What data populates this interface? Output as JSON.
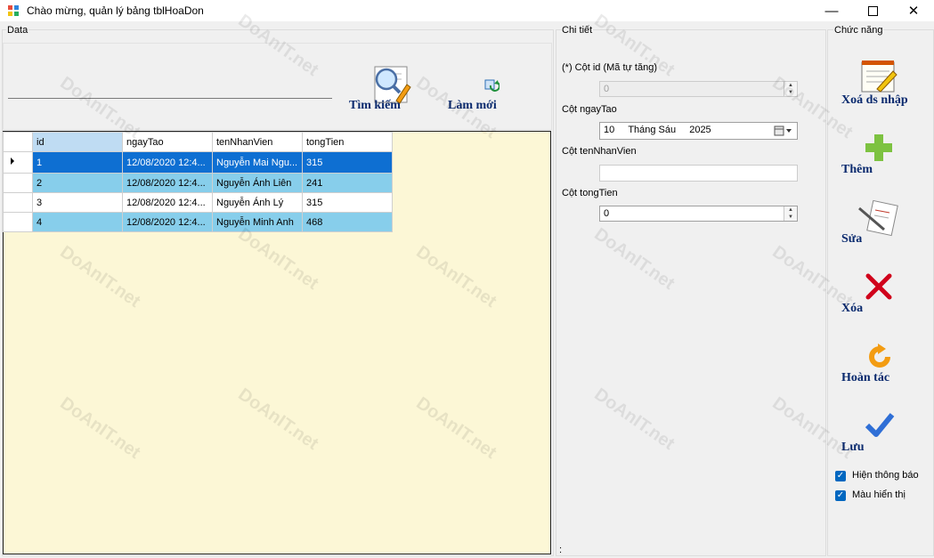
{
  "window": {
    "title": "Chào mừng, quản lý bảng tblHoaDon",
    "minimize_icon": "minimize-icon",
    "maximize_icon": "maximize-icon",
    "close_icon": "close-icon"
  },
  "data_group": {
    "label": "Data",
    "search": {
      "value": "",
      "placeholder": ""
    },
    "search_button": "Tìm kiếm",
    "refresh_button": "Làm mới",
    "grid": {
      "columns": [
        "id",
        "ngayTao",
        "tenNhanVien",
        "tongTien"
      ],
      "rows": [
        [
          "1",
          "12/08/2020 12:4...",
          "Nguyễn Mai Ngu...",
          "315"
        ],
        [
          "2",
          "12/08/2020 12:4...",
          "Nguyễn Ánh Liên",
          "241"
        ],
        [
          "3",
          "12/08/2020 12:4...",
          "Nguyễn Ánh Lý",
          "315"
        ],
        [
          "4",
          "12/08/2020 12:4...",
          "Nguyễn Minh Anh",
          "468"
        ]
      ]
    }
  },
  "detail_group": {
    "label": "Chi tiết",
    "id_label": "(*) Cột id (Mã tự tăng)",
    "id_value": "0",
    "ngaytao_label": "Cột ngayTao",
    "date_day": "10",
    "date_month": "Tháng Sáu",
    "date_year": "2025",
    "tennv_label": "Cột tenNhanVien",
    "tennv_value": "",
    "tongtien_label": "Cột tongTien",
    "tongtien_value": "0",
    "footer": ":"
  },
  "function_group": {
    "label": "Chức năng",
    "clear_button": "Xoá ds nhập",
    "add_button": "Thêm",
    "edit_button": "Sửa",
    "delete_button": "Xóa",
    "undo_button": "Hoàn tác",
    "save_button": "Lưu",
    "show_message_label": "Hiện thông báo",
    "color_display_label": "Màu hiển thị"
  },
  "watermark": "DoAnIT.net"
}
